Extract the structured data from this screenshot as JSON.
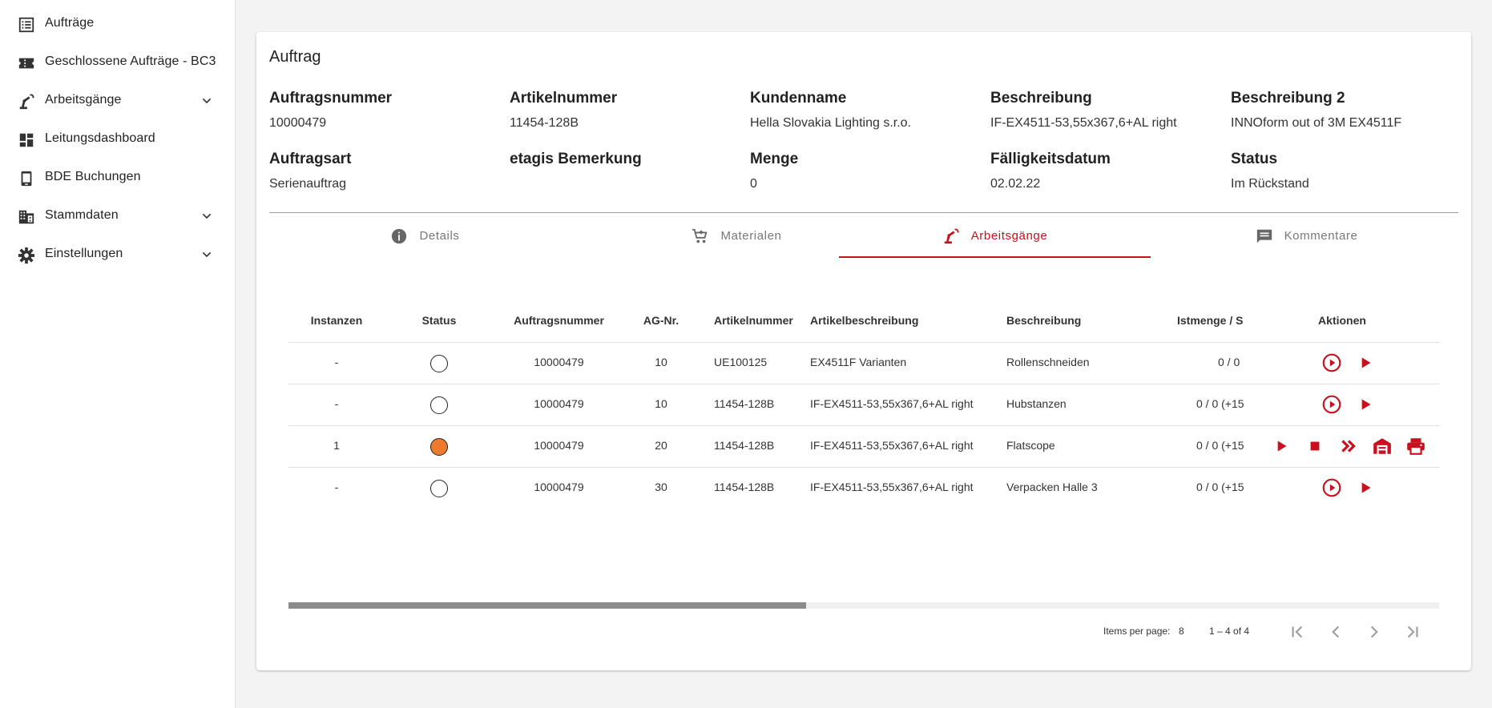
{
  "sidebar": {
    "items": [
      {
        "label": "Aufträge",
        "icon": "list-icon",
        "expandable": false
      },
      {
        "label": "Geschlossene Aufträge - BC3",
        "icon": "ticket-icon",
        "expandable": false
      },
      {
        "label": "Arbeitsgänge",
        "icon": "robot-arm-icon",
        "expandable": true
      },
      {
        "label": "Leitungsdashboard",
        "icon": "dashboard-icon",
        "expandable": false
      },
      {
        "label": "BDE Buchungen",
        "icon": "tablet-icon",
        "expandable": false
      },
      {
        "label": "Stammdaten",
        "icon": "building-icon",
        "expandable": true
      },
      {
        "label": "Einstellungen",
        "icon": "gear-icon",
        "expandable": true
      }
    ]
  },
  "order": {
    "title": "Auftrag",
    "fields": [
      {
        "label": "Auftragsnummer",
        "value": "10000479"
      },
      {
        "label": "Artikelnummer",
        "value": "11454-128B"
      },
      {
        "label": "Kundenname",
        "value": "Hella Slovakia Lighting s.r.o."
      },
      {
        "label": "Beschreibung",
        "value": "IF-EX4511-53,55x367,6+AL right"
      },
      {
        "label": "Beschreibung 2",
        "value": "INNOform out of 3M EX4511F"
      },
      {
        "label": "Auftragsart",
        "value": "Serienauftrag"
      },
      {
        "label": "etagis Bemerkung",
        "value": ""
      },
      {
        "label": "Menge",
        "value": "0"
      },
      {
        "label": "Fälligkeitsdatum",
        "value": "02.02.22"
      },
      {
        "label": "Status",
        "value": "Im Rückstand"
      }
    ]
  },
  "tabs": [
    {
      "label": "Details",
      "icon": "info-icon",
      "active": false
    },
    {
      "label": "Materialen",
      "icon": "cart-icon",
      "active": false
    },
    {
      "label": "Arbeitsgänge",
      "icon": "robot-arm-icon",
      "active": true
    },
    {
      "label": "Kommentare",
      "icon": "comment-icon",
      "active": false
    }
  ],
  "table": {
    "columns": [
      "Instanzen",
      "Status",
      "Auftragsnummer",
      "AG-Nr.",
      "Artikelnummer",
      "Artikelbeschreibung",
      "Beschreibung",
      "Istmenge / S",
      "Aktionen"
    ],
    "rows": [
      {
        "instanzen": "-",
        "status": "idle",
        "auftragsnummer": "10000479",
        "ag_nr": "10",
        "artikelnummer": "UE100125",
        "artikelbeschreibung": "EX4511F Varianten",
        "beschreibung": "Rollenschneiden",
        "istmenge": "0 / 0",
        "actions": [
          "play-circle-icon",
          "play-icon"
        ]
      },
      {
        "instanzen": "-",
        "status": "idle",
        "auftragsnummer": "10000479",
        "ag_nr": "10",
        "artikelnummer": "11454-128B",
        "artikelbeschreibung": "IF-EX4511-53,55x367,6+AL right",
        "beschreibung": "Hubstanzen",
        "istmenge": "0 / 0 (+15",
        "actions": [
          "play-circle-icon",
          "play-icon"
        ]
      },
      {
        "instanzen": "1",
        "status": "running",
        "auftragsnummer": "10000479",
        "ag_nr": "20",
        "artikelnummer": "11454-128B",
        "artikelbeschreibung": "IF-EX4511-53,55x367,6+AL right",
        "beschreibung": "Flatscope",
        "istmenge": "0 / 0 (+15",
        "actions": [
          "play-icon",
          "stop-icon",
          "double-chevron-icon",
          "garage-icon",
          "print-icon"
        ]
      },
      {
        "instanzen": "-",
        "status": "idle",
        "auftragsnummer": "10000479",
        "ag_nr": "30",
        "artikelnummer": "11454-128B",
        "artikelbeschreibung": "IF-EX4511-53,55x367,6+AL right",
        "beschreibung": "Verpacken Halle 3",
        "istmenge": "0 / 0 (+15",
        "actions": [
          "play-circle-icon",
          "play-icon"
        ]
      }
    ],
    "scroll_fraction": 0.45
  },
  "paginator": {
    "items_per_page_label": "Items per page:",
    "items_per_page_value": "8",
    "range": "1 – 4 of 4"
  },
  "colors": {
    "accent": "#c8101e",
    "running": "#ee7a2e"
  }
}
